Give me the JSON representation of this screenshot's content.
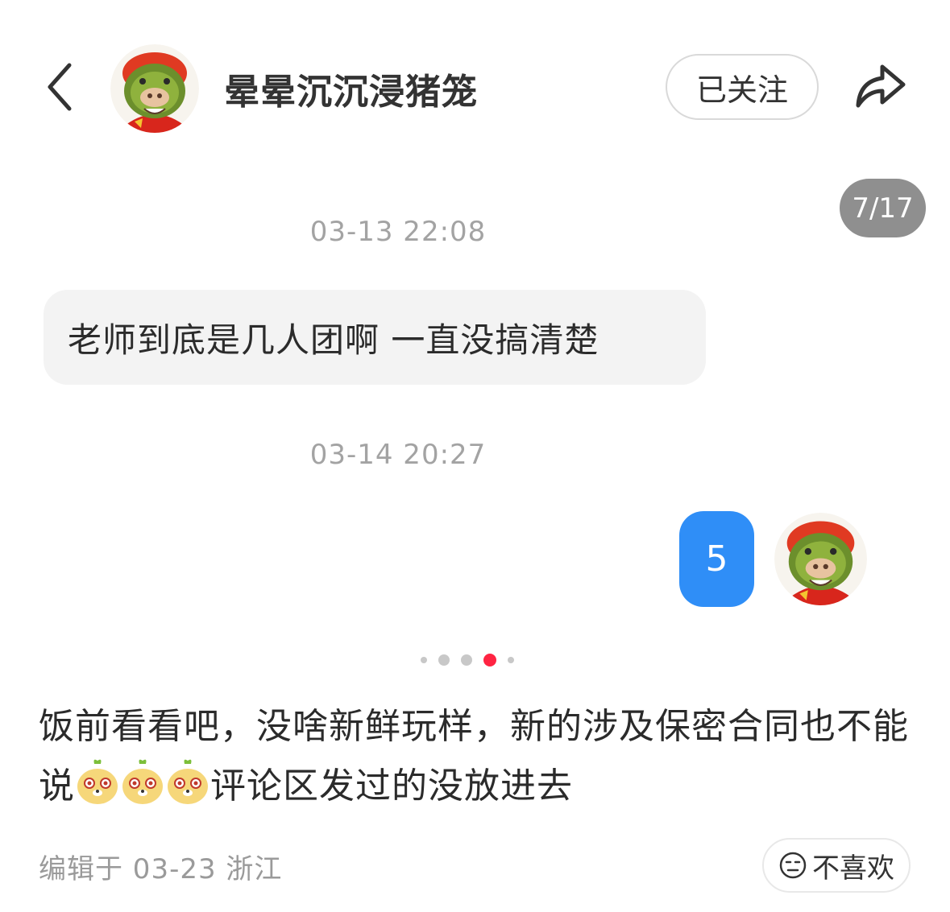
{
  "header": {
    "username": "晕晕沉沉浸猪笼",
    "follow_label": "已关注"
  },
  "image": {
    "page_counter": "7/17",
    "chat": {
      "timestamp_1": "03-13 22:08",
      "incoming_message": "老师到底是几人团啊 一直没搞清楚",
      "timestamp_2": "03-14 20:27",
      "outgoing_message": "5"
    },
    "carousel": {
      "dot_count": 5,
      "active_index": 3,
      "accent_color": "#ff2442"
    }
  },
  "post": {
    "text_part_1": "饭前看看吧，没啥新鲜玩样，新的涉及保密合同也不能说",
    "emoji_icons": [
      "sweet-potato-emoji-icon",
      "sweet-potato-emoji-icon",
      "sweet-potato-emoji-icon"
    ],
    "text_part_2": "评论区发过的没放进去"
  },
  "footer": {
    "meta": "编辑于 03-23 浙江",
    "dislike_label": "不喜欢"
  },
  "colors": {
    "bubble_out": "#2f8ef7",
    "bubble_in": "#f3f3f3",
    "counter_bg": "#8f8f8f"
  }
}
